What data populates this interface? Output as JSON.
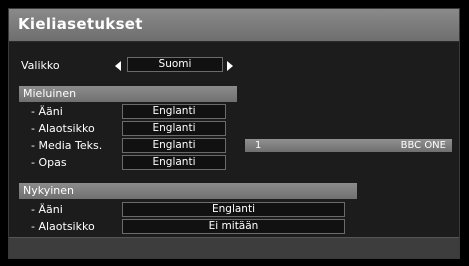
{
  "title": "Kieliasetukset",
  "menu": {
    "label": "Valikko",
    "value": "Suomi"
  },
  "preferred": {
    "header": "Mieluinen",
    "rows": [
      {
        "label": "- Ääni",
        "value": "Englanti"
      },
      {
        "label": "- Alaotsikko",
        "value": "Englanti"
      },
      {
        "label": "- Media Teks.",
        "value": "Englanti"
      },
      {
        "label": "- Opas",
        "value": "Englanti"
      }
    ],
    "channel": {
      "number": "1",
      "name": "BBC ONE"
    }
  },
  "current": {
    "header": "Nykyinen",
    "rows": [
      {
        "label": "- Ääni",
        "value": "Englanti"
      },
      {
        "label": "- Alaotsikko",
        "value": "Ei mitään"
      }
    ]
  }
}
